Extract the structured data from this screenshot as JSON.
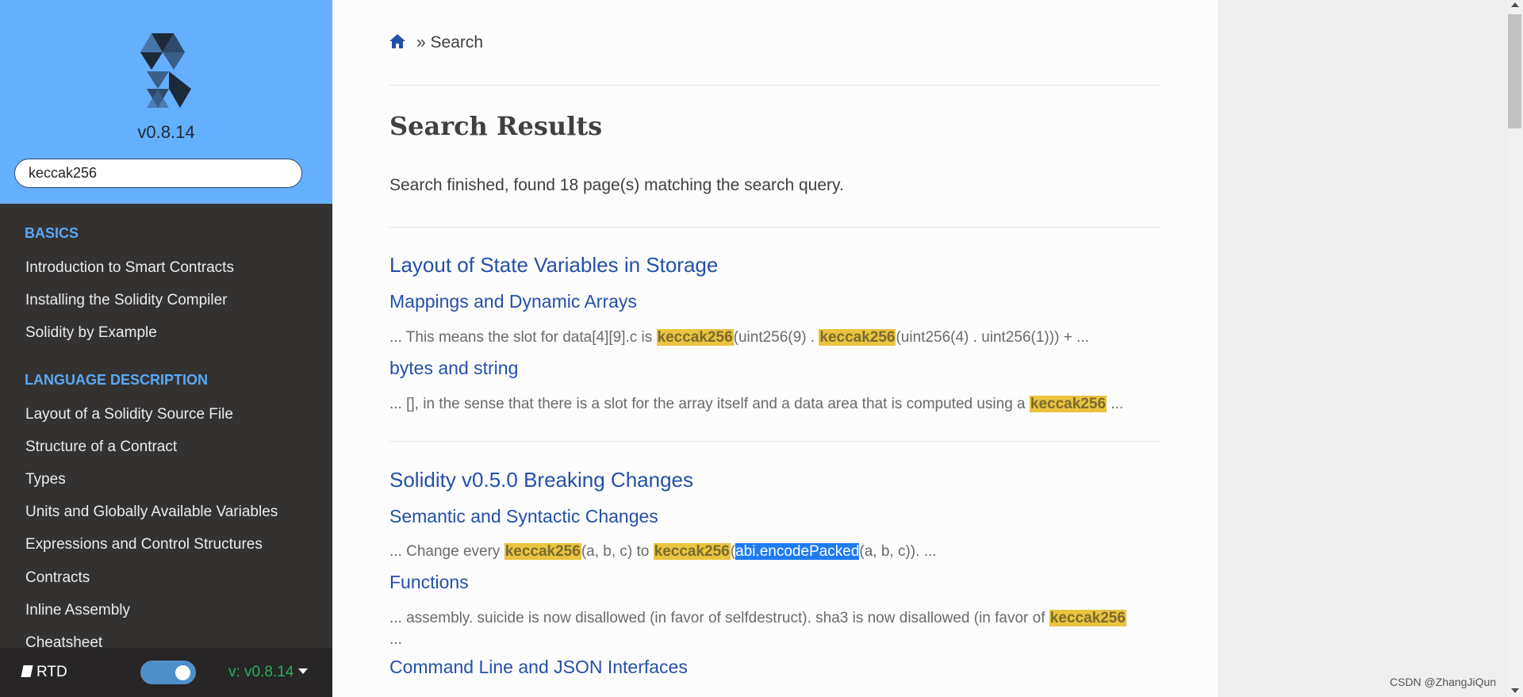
{
  "sidebar": {
    "version": "v0.8.14",
    "search_value": "keccak256",
    "sections": [
      {
        "caption": "BASICS",
        "items": [
          "Introduction to Smart Contracts",
          "Installing the Solidity Compiler",
          "Solidity by Example"
        ]
      },
      {
        "caption": "LANGUAGE DESCRIPTION",
        "items": [
          "Layout of a Solidity Source File",
          "Structure of a Contract",
          "Types",
          "Units and Globally Available Variables",
          "Expressions and Control Structures",
          "Contracts",
          "Inline Assembly",
          "Cheatsheet"
        ]
      }
    ],
    "rtd": {
      "label": "RTD",
      "version_label": "v: v0.8.14",
      "toggle_on": true
    }
  },
  "breadcrumb": {
    "separator": "»",
    "current": "Search"
  },
  "page": {
    "title": "Search Results",
    "status": "Search finished, found 18 page(s) matching the search query."
  },
  "results": [
    {
      "title": "Layout of State Variables in Storage",
      "sections": [
        {
          "title": "Mappings and Dynamic Arrays",
          "snippet": [
            [
              "... This means the slot for data[4][9].c is ",
              false
            ],
            [
              "keccak256",
              true
            ],
            [
              "(uint256(9) . ",
              false
            ],
            [
              "keccak256",
              true
            ],
            [
              "(uint256(4) . uint256(1))) + ...",
              false
            ]
          ]
        },
        {
          "title": "bytes and string",
          "snippet": [
            [
              "... [], in the sense that there is a slot for the array itself and a data area that is computed using a ",
              false
            ],
            [
              "keccak256",
              true
            ],
            [
              " ...",
              false
            ]
          ]
        }
      ]
    },
    {
      "title": "Solidity v0.5.0 Breaking Changes",
      "sections": [
        {
          "title": "Semantic and Syntactic Changes",
          "snippet": [
            [
              "... Change every ",
              false
            ],
            [
              "keccak256",
              true
            ],
            [
              "(a, b, c) to ",
              false
            ],
            [
              "keccak256",
              true
            ],
            [
              "(",
              false
            ],
            [
              "abi.encodePacked",
              "sel"
            ],
            [
              "(a, b, c)). ...",
              false
            ]
          ]
        },
        {
          "title": "Functions",
          "snippet": [
            [
              "... assembly. suicide is now disallowed (in favor of selfdestruct). sha3 is now disallowed (in favor of ",
              false
            ],
            [
              "keccak256",
              true
            ]
          ],
          "snippet_cont": "..."
        }
      ]
    },
    {
      "title": "Command Line and JSON Interfaces",
      "sections": []
    }
  ],
  "watermark": "CSDN @ZhangJiQun",
  "colors": {
    "sidebar_top": "#65afff",
    "sidebar_bg": "#343131",
    "link": "#2450a8",
    "highlight": "#eac33f",
    "caption": "#5aa9f5"
  }
}
